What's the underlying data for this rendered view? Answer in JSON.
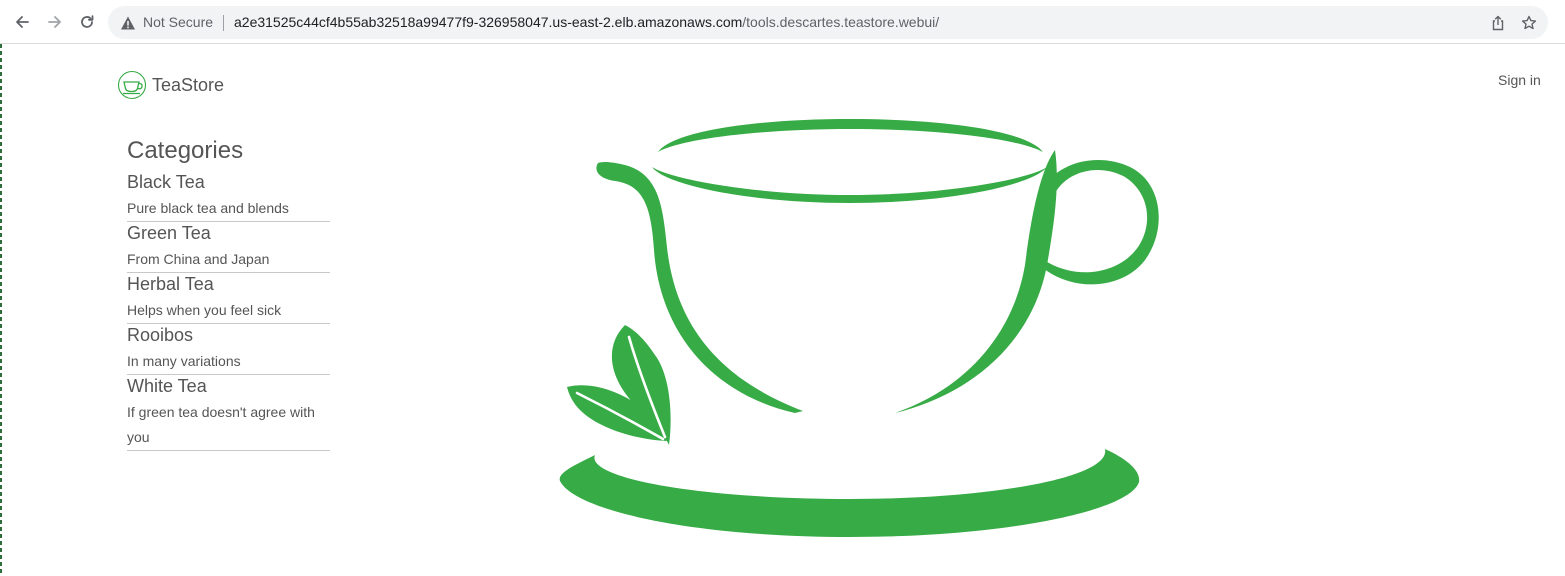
{
  "browser": {
    "security_label": "Not Secure",
    "url_host": "a2e31525c44cf4b55ab32518a99477f9-326958047.us-east-2.elb.amazonaws.com",
    "url_path": "/tools.descartes.teastore.webui/",
    "icons": [
      "back-arrow-icon",
      "forward-arrow-icon",
      "reload-icon",
      "warning-icon",
      "share-icon",
      "star-icon"
    ]
  },
  "header": {
    "brand": "TeaStore",
    "sign_in": "Sign in"
  },
  "sidebar": {
    "heading": "Categories",
    "items": [
      {
        "name": "Black Tea",
        "description": "Pure black tea and blends"
      },
      {
        "name": "Green Tea",
        "description": "From China and Japan"
      },
      {
        "name": "Herbal Tea",
        "description": "Helps when you feel sick"
      },
      {
        "name": "Rooibos",
        "description": "In many variations"
      },
      {
        "name": "White Tea",
        "description": "If green tea doesn't agree with you"
      }
    ]
  },
  "colors": {
    "brand_green": "#37ab46",
    "text": "#555555"
  }
}
